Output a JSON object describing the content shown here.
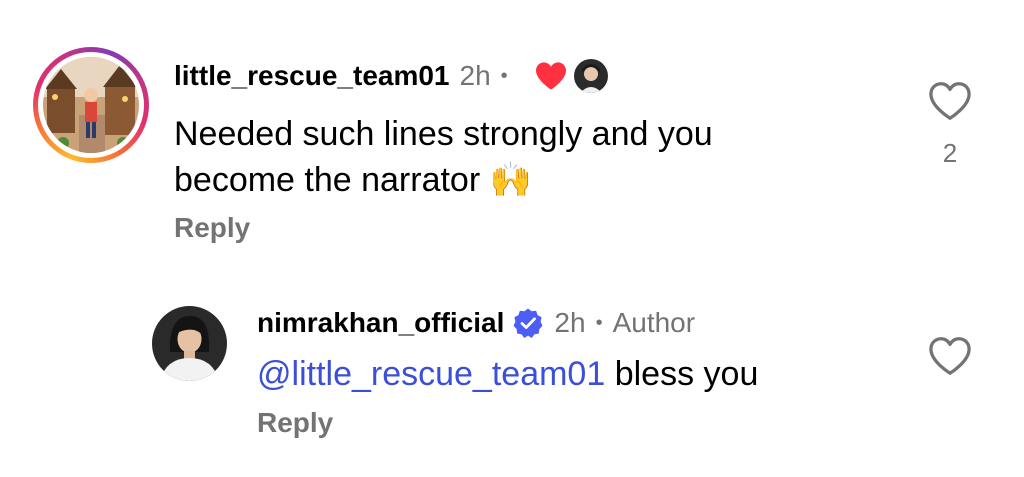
{
  "comments": [
    {
      "username": "little_rescue_team01",
      "time": "2h",
      "separator": "•",
      "text": "Needed such lines strongly and you",
      "text_line2": "become the narrator 🙌",
      "reply_label": "Reply",
      "like_count": "2",
      "liked_by_author_icon": "heart-filled-red"
    },
    {
      "username": "nimrakhan_official",
      "verified_icon": "verified-badge",
      "time": "2h",
      "separator": "•",
      "author_label": "Author",
      "mention": "@little_rescue_team01",
      "text": " bless you",
      "reply_label": "Reply"
    }
  ],
  "colors": {
    "meta_gray": "#737373",
    "mention_blue": "#3b4fd8",
    "heart_red": "#ff3040",
    "verified_blue": "#4d5ef5"
  }
}
